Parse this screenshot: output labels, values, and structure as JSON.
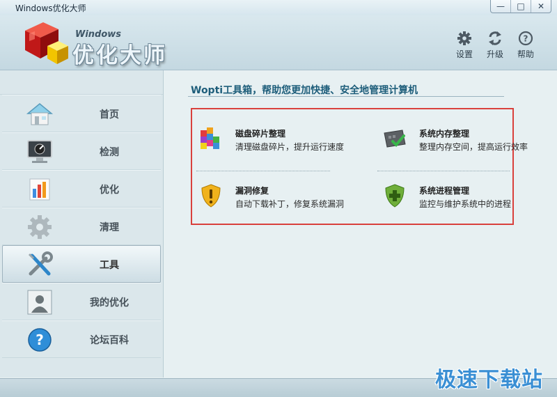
{
  "window": {
    "title": "Windows优化大师",
    "controls": [
      "—",
      "□",
      "✕"
    ]
  },
  "header": {
    "logo_small": "Windows",
    "logo_big": "优化大师",
    "buttons": [
      {
        "label": "设置",
        "icon": "gear-icon"
      },
      {
        "label": "升级",
        "icon": "refresh-icon"
      },
      {
        "label": "帮助",
        "icon": "help-icon"
      }
    ]
  },
  "sidebar": {
    "items": [
      {
        "label": "首页",
        "icon": "home-icon",
        "active": false
      },
      {
        "label": "检测",
        "icon": "monitor-icon",
        "active": false
      },
      {
        "label": "优化",
        "icon": "bar-chart-icon",
        "active": false
      },
      {
        "label": "清理",
        "icon": "gear-icon",
        "active": false
      },
      {
        "label": "工具",
        "icon": "wrench-icon",
        "active": true
      },
      {
        "label": "我的优化",
        "icon": "user-icon",
        "active": false
      },
      {
        "label": "论坛百科",
        "icon": "question-icon",
        "active": false
      }
    ]
  },
  "main": {
    "title": "Wopti工具箱，帮助您更加快捷、安全地管理计算机",
    "tools": [
      {
        "name": "磁盘碎片整理",
        "desc": "清理磁盘碎片，提升运行速度",
        "icon": "disk-defrag-icon"
      },
      {
        "name": "系统内存整理",
        "desc": "整理内存空间，提高运行效率",
        "icon": "memory-icon"
      },
      {
        "name": "漏洞修复",
        "desc": "自动下载补丁，修复系统漏洞",
        "icon": "warning-shield-icon"
      },
      {
        "name": "系统进程管理",
        "desc": "监控与维护系统中的进程",
        "icon": "process-shield-icon"
      }
    ]
  },
  "watermark": "极速下载站",
  "colors": {
    "accent": "#1d5d7a",
    "highlight_border": "#d9403c",
    "watermark": "#3a8fd4"
  }
}
